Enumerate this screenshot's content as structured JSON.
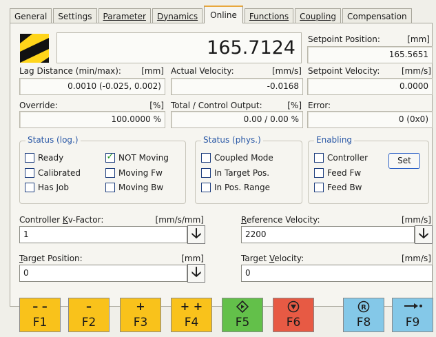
{
  "tabs": [
    "General",
    "Settings",
    "Parameter",
    "Dynamics",
    "Online",
    "Functions",
    "Coupling",
    "Compensation"
  ],
  "active_tab": "Online",
  "position": {
    "value": "165.7124"
  },
  "setpoint_position": {
    "label": "Setpoint Position:",
    "unit": "[mm]",
    "value": "165.5651"
  },
  "lag_distance": {
    "label": "Lag Distance (min/max):",
    "unit": "[mm]",
    "value": "0.0010  (-0.025, 0.002)"
  },
  "actual_velocity": {
    "label": "Actual Velocity:",
    "unit": "[mm/s]",
    "value": "-0.0168"
  },
  "setpoint_velocity": {
    "label": "Setpoint Velocity:",
    "unit": "[mm/s]",
    "value": "0.0000"
  },
  "override": {
    "label": "Override:",
    "unit": "[%]",
    "value": "100.0000 %"
  },
  "total_output": {
    "label": "Total / Control Output:",
    "unit": "[%]",
    "value": "0.00 /  0.00 %"
  },
  "error": {
    "label": "Error:",
    "value": "0 (0x0)"
  },
  "status_log": {
    "title": "Status (log.)",
    "items": [
      {
        "label": "Ready",
        "checked": false
      },
      {
        "label": "Calibrated",
        "checked": false
      },
      {
        "label": "Has Job",
        "checked": false
      },
      {
        "label": "NOT Moving",
        "checked": true
      },
      {
        "label": "Moving Fw",
        "checked": false
      },
      {
        "label": "Moving Bw",
        "checked": false
      }
    ]
  },
  "status_phys": {
    "title": "Status (phys.)",
    "items": [
      {
        "label": "Coupled Mode",
        "checked": false
      },
      {
        "label": "In Target Pos.",
        "checked": false
      },
      {
        "label": "In Pos. Range",
        "checked": false
      }
    ]
  },
  "enabling": {
    "title": "Enabling",
    "items": [
      {
        "label": "Controller",
        "checked": false
      },
      {
        "label": "Feed Fw",
        "checked": false
      },
      {
        "label": "Feed Bw",
        "checked": false
      }
    ],
    "set_label": "Set"
  },
  "kv_factor": {
    "label_pre": "Controller ",
    "label_ul": "K",
    "label_post": "v-Factor:",
    "unit": "[mm/s/mm]",
    "value": "1"
  },
  "reference_velocity": {
    "label_ul": "R",
    "label_post": "eference Velocity:",
    "unit": "[mm/s]",
    "value": "2200"
  },
  "target_position": {
    "label_ul": "T",
    "label_post": "arget Position:",
    "unit": "[mm]",
    "value": "0"
  },
  "target_velocity": {
    "label_pre": "Target ",
    "label_ul": "V",
    "label_post": "elocity:",
    "unit": "[mm/s]",
    "value": "0"
  },
  "fkeys": [
    {
      "name": "F1",
      "symbol": "– –",
      "color": "#f9c21b"
    },
    {
      "name": "F2",
      "symbol": "–",
      "color": "#f9c21b"
    },
    {
      "name": "F3",
      "symbol": "+",
      "color": "#f9c21b"
    },
    {
      "name": "F4",
      "symbol": "+ +",
      "color": "#f9c21b"
    },
    {
      "name": "F5",
      "symbol": "diamond-icon",
      "color": "#63c04a"
    },
    {
      "name": "F6",
      "symbol": "stop-icon",
      "color": "#e75a44"
    },
    {
      "name": "F8",
      "symbol": "reference-icon",
      "color": "#84c8e8"
    },
    {
      "name": "F9",
      "symbol": "goto-icon",
      "color": "#84c8e8"
    }
  ]
}
